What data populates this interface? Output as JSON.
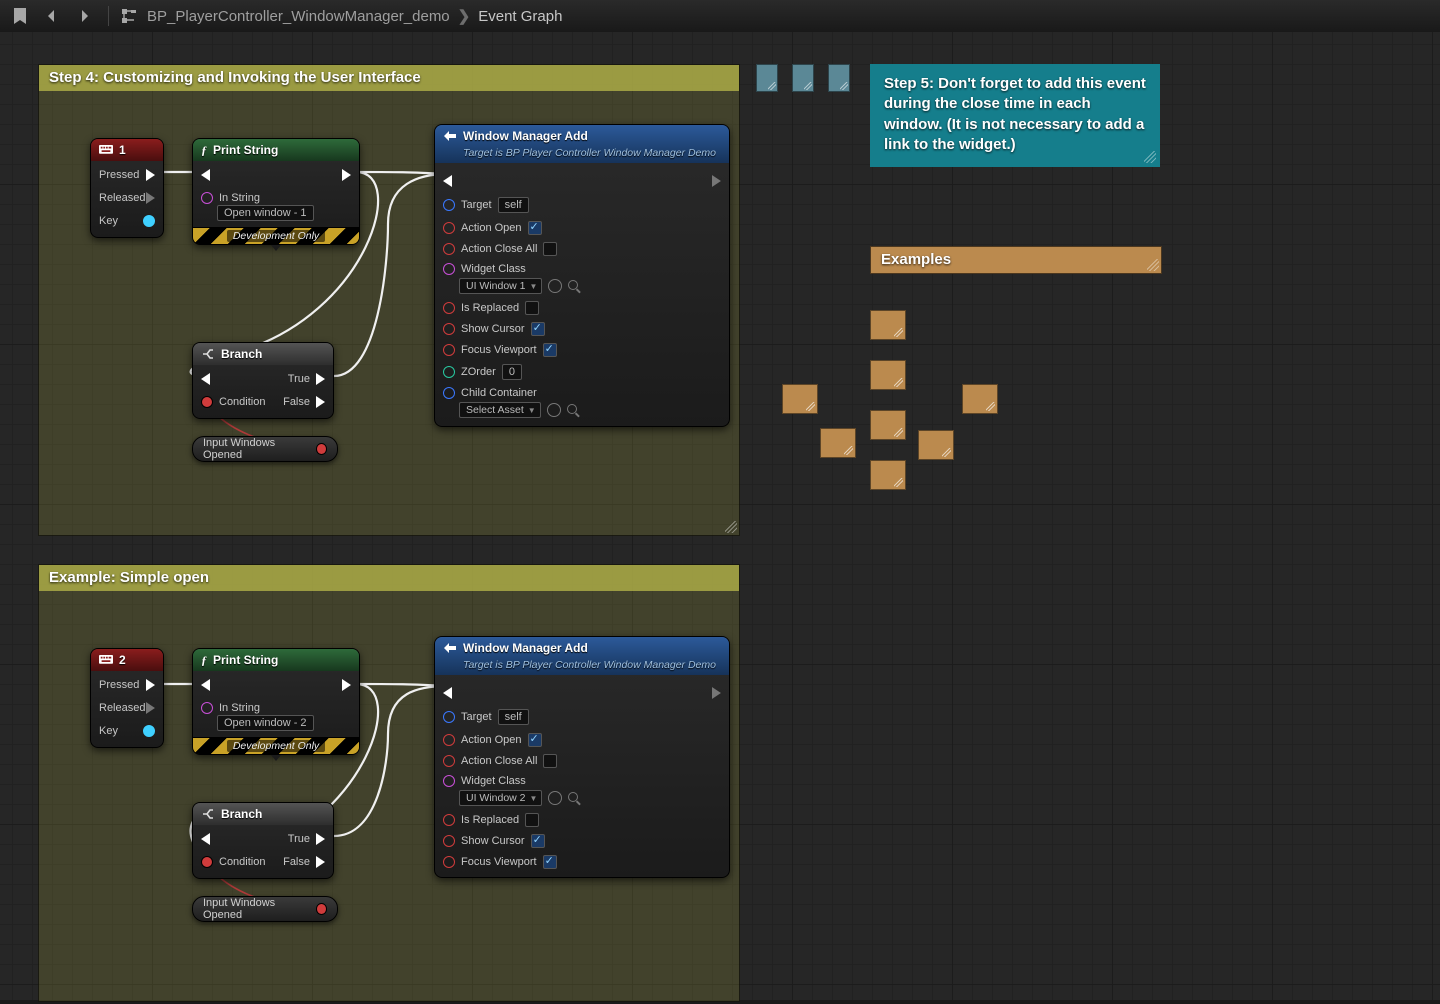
{
  "breadcrumb": {
    "level1": "BP_PlayerController_WindowManager_demo",
    "level2": "Event Graph"
  },
  "region1": {
    "title": "Step 4: Customizing and Invoking the User Interface"
  },
  "region2": {
    "title": "Example: Simple open"
  },
  "region_step5": {
    "text": "Step 5: Don't forget to add this event during the close time in each window. (It is not necessary to add a link to the widget.)"
  },
  "region_examples": {
    "title": "Examples"
  },
  "kb1": {
    "title": "1",
    "pressed": "Pressed",
    "released": "Released",
    "key": "Key"
  },
  "kb2": {
    "title": "2",
    "pressed": "Pressed",
    "released": "Released",
    "key": "Key"
  },
  "print1": {
    "title": "Print String",
    "in_label": "In String",
    "in_value": "Open window - 1",
    "dev": "Development Only"
  },
  "print2": {
    "title": "Print String",
    "in_label": "In String",
    "in_value": "Open window - 2",
    "dev": "Development Only"
  },
  "branch": {
    "title": "Branch",
    "cond": "Condition",
    "t": "True",
    "f": "False"
  },
  "var1": {
    "label": "Input Windows Opened"
  },
  "wm1": {
    "title": "Window Manager Add",
    "subtitle": "Target is BP Player Controller Window Manager Demo",
    "target": "Target",
    "self": "self",
    "action_open": "Action Open",
    "action_close_all": "Action Close All",
    "widget_class": "Widget Class",
    "widget_class_val": "UI Window 1",
    "is_replaced": "Is Replaced",
    "show_cursor": "Show Cursor",
    "focus_viewport": "Focus Viewport",
    "zorder": "ZOrder",
    "zorder_val": "0",
    "child_container": "Child Container",
    "child_val": "Select Asset"
  },
  "wm2": {
    "title": "Window Manager Add",
    "subtitle": "Target is BP Player Controller Window Manager Demo",
    "target": "Target",
    "self": "self",
    "action_open": "Action Open",
    "action_close_all": "Action Close All",
    "widget_class": "Widget Class",
    "widget_class_val": "UI Window 2",
    "is_replaced": "Is Replaced",
    "show_cursor": "Show Cursor",
    "focus_viewport": "Focus Viewport"
  }
}
